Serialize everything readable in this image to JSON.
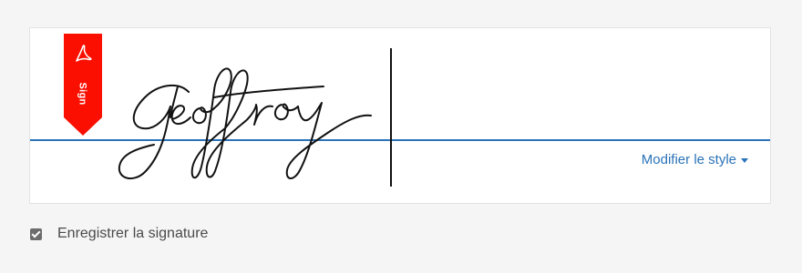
{
  "signature_panel": {
    "sign_badge_label": "Sign",
    "signature_text": "Geoffroy",
    "modify_style_label": "Modifier le style",
    "accent_color": "#2a73b8",
    "badge_color": "#fa0f00"
  },
  "save_option": {
    "label": "Enregistrer la signature",
    "checked": true
  },
  "icons": [
    "adobe-acrobat-icon",
    "caret-down-icon",
    "checkbox-checked-icon"
  ]
}
